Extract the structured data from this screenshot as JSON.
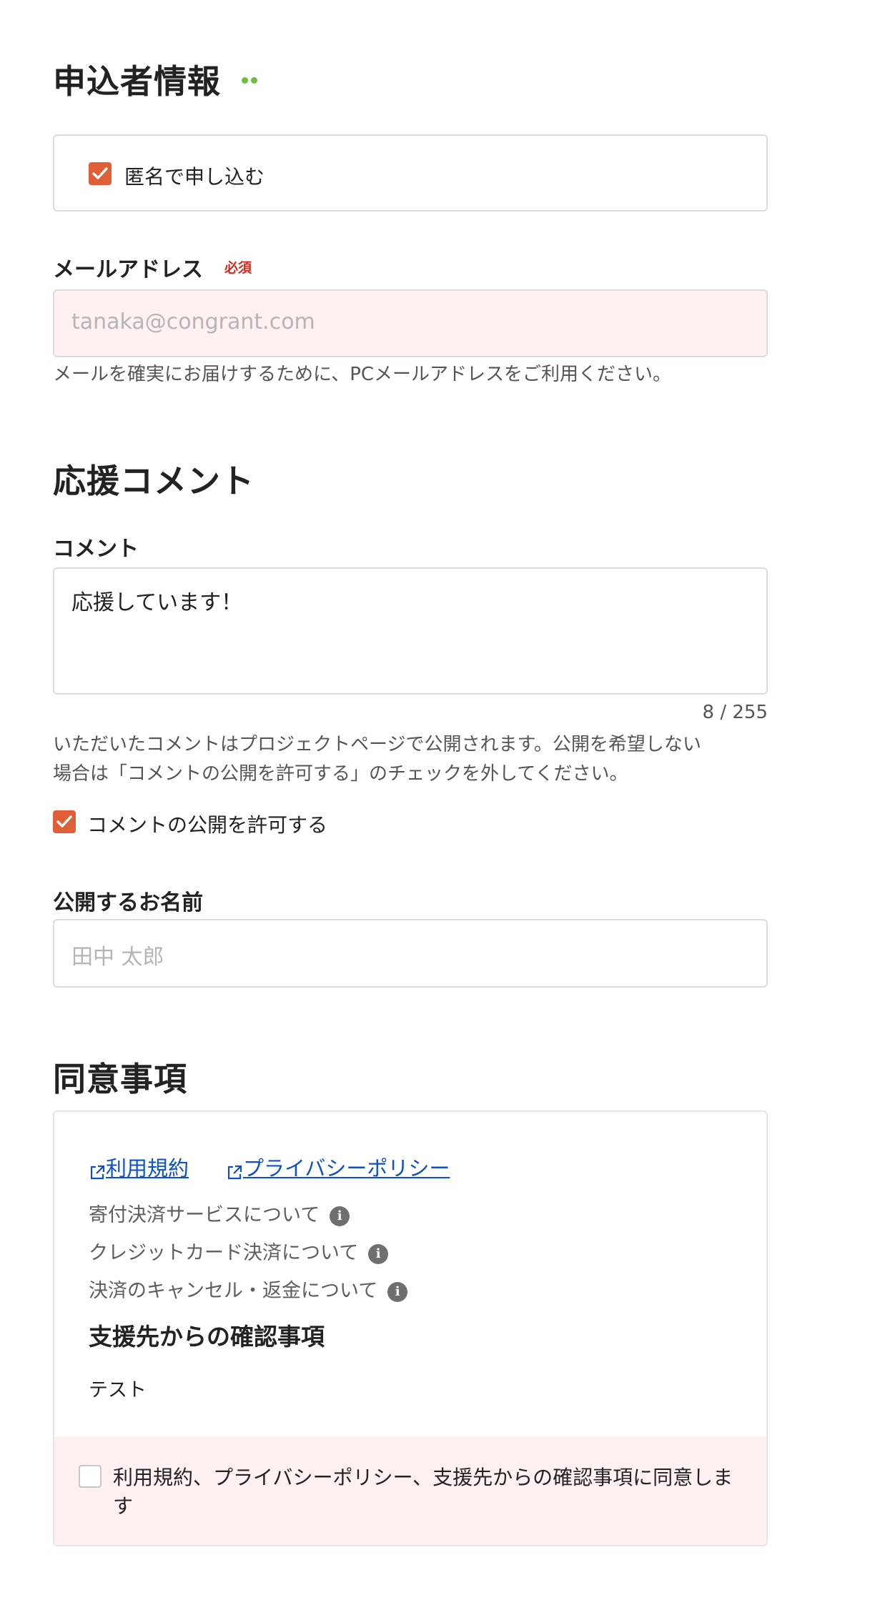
{
  "applicant": {
    "title": "申込者情報",
    "anonymous_label": "匿名で申し込む",
    "anonymous_checked": true
  },
  "email": {
    "label": "メールアドレス",
    "required_badge": "必須",
    "placeholder": "tanaka@congrant.com",
    "value": "",
    "help": "メールを確実にお届けするために、PCメールアドレスをご利用ください。"
  },
  "comment_section": {
    "title": "応援コメント",
    "label": "コメント",
    "value": "応援しています！",
    "counter": "8 / 255",
    "help_line1": "いただいたコメントはプロジェクトページで公開されます。公開を希望しない",
    "help_line2": "場合は「コメントの公開を許可する」のチェックを外してください。",
    "publish_label": "コメントの公開を許可する",
    "publish_checked": true
  },
  "public_name": {
    "label": "公開するお名前",
    "placeholder": "田中 太郎",
    "value": ""
  },
  "agreement": {
    "title": "同意事項",
    "links": [
      {
        "label": "利用規約",
        "icon": "external-link-icon"
      },
      {
        "label": "プライバシーポリシー",
        "icon": "external-link-icon"
      }
    ],
    "info_items": [
      {
        "label": "寄付決済サービスについて",
        "icon": "info-icon"
      },
      {
        "label": "クレジットカード決済について",
        "icon": "info-icon"
      },
      {
        "label": "決済のキャンセル・返金について",
        "icon": "info-icon"
      }
    ],
    "confirm_title": "支援先からの確認事項",
    "confirm_body": "テスト",
    "agree_line1": "利用規約、プライバシーポリシー、支援先からの確認事項に同意しま",
    "agree_line2": "す",
    "agree_checked": false
  },
  "colors": {
    "accent": "#e05f36",
    "link": "#0b52c7",
    "required": "#d62a1e",
    "error_bg": "#fff1ef",
    "dots": "#6bbf3a"
  }
}
